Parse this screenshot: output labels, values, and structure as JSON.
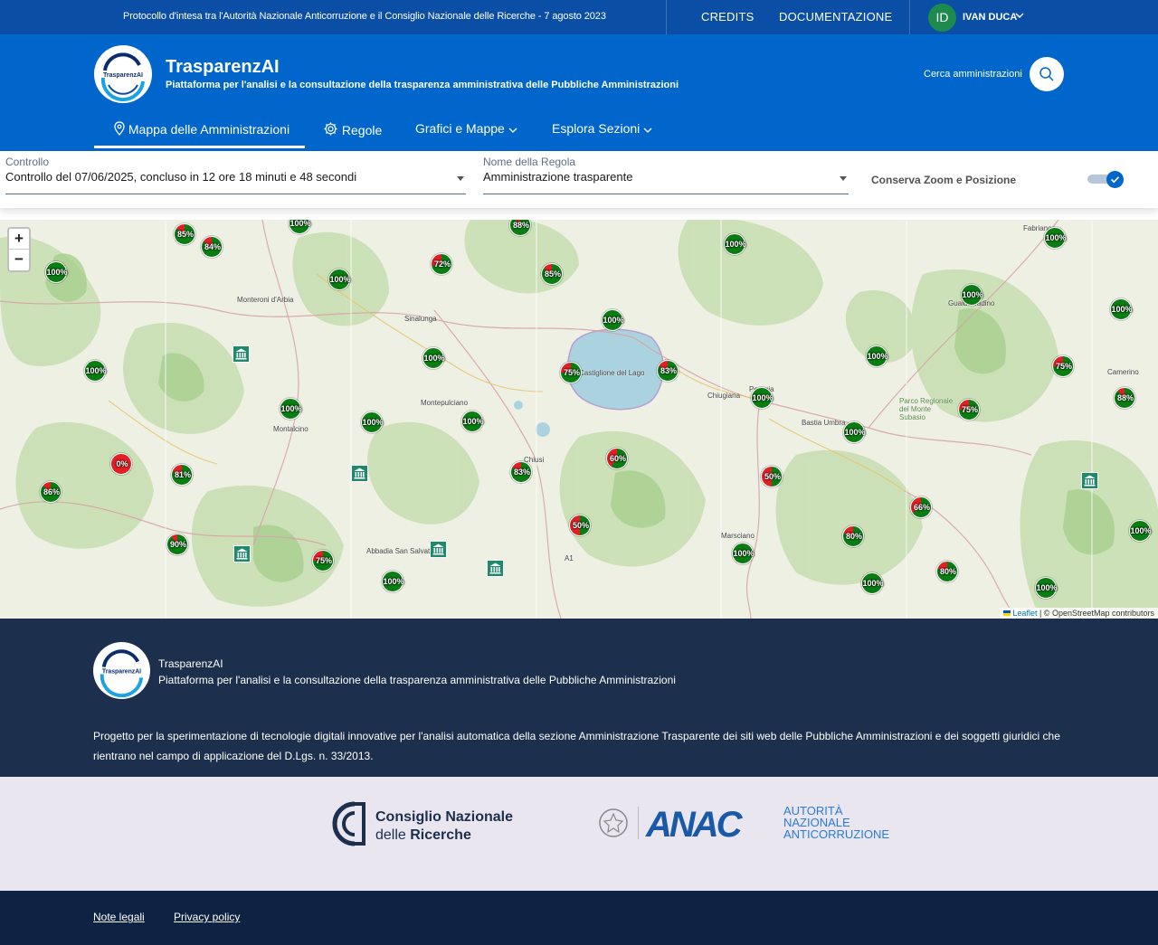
{
  "header_slim": {
    "protocol_text": "Protocollo d'intesa tra l'Autorità Nazionale Anticorruzione e il Consiglio Nazionale delle Ricerche - 7 agosto 2023",
    "credits_label": "CREDITS",
    "docs_label": "DOCUMENTAZIONE",
    "user_initials": "ID",
    "user_name": "IVAN DUCA"
  },
  "header_center": {
    "logo_text": "TrasparenzAI",
    "title": "TrasparenzAI",
    "subtitle": "Piattaforma per l'analisi e la consultazione della trasparenza amministrativa delle Pubbliche Amministrazioni",
    "search_label": "Cerca amministrazioni"
  },
  "nav": {
    "items": [
      {
        "label": "Mappa delle Amministrazioni",
        "icon": "map-pin-icon",
        "active": true
      },
      {
        "label": "Regole",
        "icon": "gear-icon",
        "active": false
      },
      {
        "label": "Grafici e Mappe",
        "icon": "chevron-down-icon",
        "active": false
      },
      {
        "label": "Esplora Sezioni",
        "icon": "chevron-down-icon",
        "active": false
      }
    ]
  },
  "filters": {
    "controllo_label": "Controllo",
    "controllo_value": "Controllo del 07/06/2025, concluso in 12 ore 18 minuti e 48 secondi",
    "regola_label": "Nome della Regola",
    "regola_value": "Amministrazione trasparente",
    "keep_label": "Conserva Zoom e Posizione",
    "keep_enabled": true
  },
  "map": {
    "zoom_in": "+",
    "zoom_out": "−",
    "attribution_leaflet": "Leaflet",
    "attribution_osm": "| © OpenStreetMap contributors",
    "colors": {
      "ok": "#0a7d12",
      "ko": "#e31e24"
    },
    "places": [
      "Montepulciano",
      "Montalcino",
      "Sinalunga",
      "Chiusi",
      "Castiglione del Lago",
      "Perugia",
      "Marsciano",
      "Bastia Umbra",
      "Abbadia San Salvatore",
      "Monteroni d'Arbia",
      "Chiugiana",
      "Gualdo Tadino",
      "Camerino",
      "Fabriano",
      "Parco Regionale del Monte Subasio",
      "A1"
    ],
    "markers": [
      {
        "label": "85%",
        "pct": 85
      },
      {
        "label": "84%",
        "pct": 84
      },
      {
        "label": "100%",
        "pct": 100
      },
      {
        "label": "100%",
        "pct": 100
      },
      {
        "label": "72%",
        "pct": 72
      },
      {
        "label": "100%",
        "pct": 100
      },
      {
        "label": "85%",
        "pct": 85
      },
      {
        "label": "88%",
        "pct": 88
      },
      {
        "label": "100%",
        "pct": 100
      },
      {
        "label": "100%",
        "pct": 100
      },
      {
        "label": "100%",
        "pct": 100
      },
      {
        "label": "100%",
        "pct": 100
      },
      {
        "label": "100%",
        "pct": 100
      },
      {
        "label": "100%",
        "pct": 100
      },
      {
        "label": "100%",
        "pct": 100
      },
      {
        "label": "75%",
        "pct": 75
      },
      {
        "label": "83%",
        "pct": 83
      },
      {
        "label": "100%",
        "pct": 100
      },
      {
        "label": "100%",
        "pct": 100
      },
      {
        "label": "75%",
        "pct": 75
      },
      {
        "label": "100%",
        "pct": 100
      },
      {
        "label": "100%",
        "pct": 100
      },
      {
        "label": "100%",
        "pct": 100
      },
      {
        "label": "75%",
        "pct": 75
      },
      {
        "label": "88%",
        "pct": 88
      },
      {
        "label": "100%",
        "pct": 100
      },
      {
        "label": "0%",
        "pct": 0
      },
      {
        "label": "81%",
        "pct": 81
      },
      {
        "label": "83%",
        "pct": 83
      },
      {
        "label": "60%",
        "pct": 60
      },
      {
        "label": "50%",
        "pct": 50
      },
      {
        "label": "86%",
        "pct": 86
      },
      {
        "label": "66%",
        "pct": 66
      },
      {
        "label": "90%",
        "pct": 90
      },
      {
        "label": "50%",
        "pct": 50
      },
      {
        "label": "80%",
        "pct": 80
      },
      {
        "label": "75%",
        "pct": 75
      },
      {
        "label": "100%",
        "pct": 100
      },
      {
        "label": "100%",
        "pct": 100
      },
      {
        "label": "80%",
        "pct": 80
      },
      {
        "label": "100%",
        "pct": 100
      },
      {
        "label": "100%",
        "pct": 100
      },
      {
        "label": "100%",
        "pct": 100
      }
    ]
  },
  "footer": {
    "title": "TrasparenzAI",
    "subtitle": "Piattaforma per l'analisi e la consultazione della trasparenza amministrativa delle Pubbliche Amministrazioni",
    "description": "Progetto per la sperimentazione di tecnologie digitali innovative per l'analisi automatica della sezione Amministrazione Trasparente dei siti web delle Pubbliche Amministrazioni e dei soggetti giuridici che rientrano nel campo di applicazione del D.Lgs. n. 33/2013.",
    "cnr_line1": "Consiglio Nazionale",
    "cnr_line2a": "delle ",
    "cnr_line2b": "Ricerche",
    "anac_wordmark": "ANAC",
    "anac_line1": "AUTORITÀ",
    "anac_line2": "NAZIONALE",
    "anac_line3": "ANTICORRUZIONE",
    "legal_label": "Note legali",
    "privacy_label": "Privacy policy"
  }
}
